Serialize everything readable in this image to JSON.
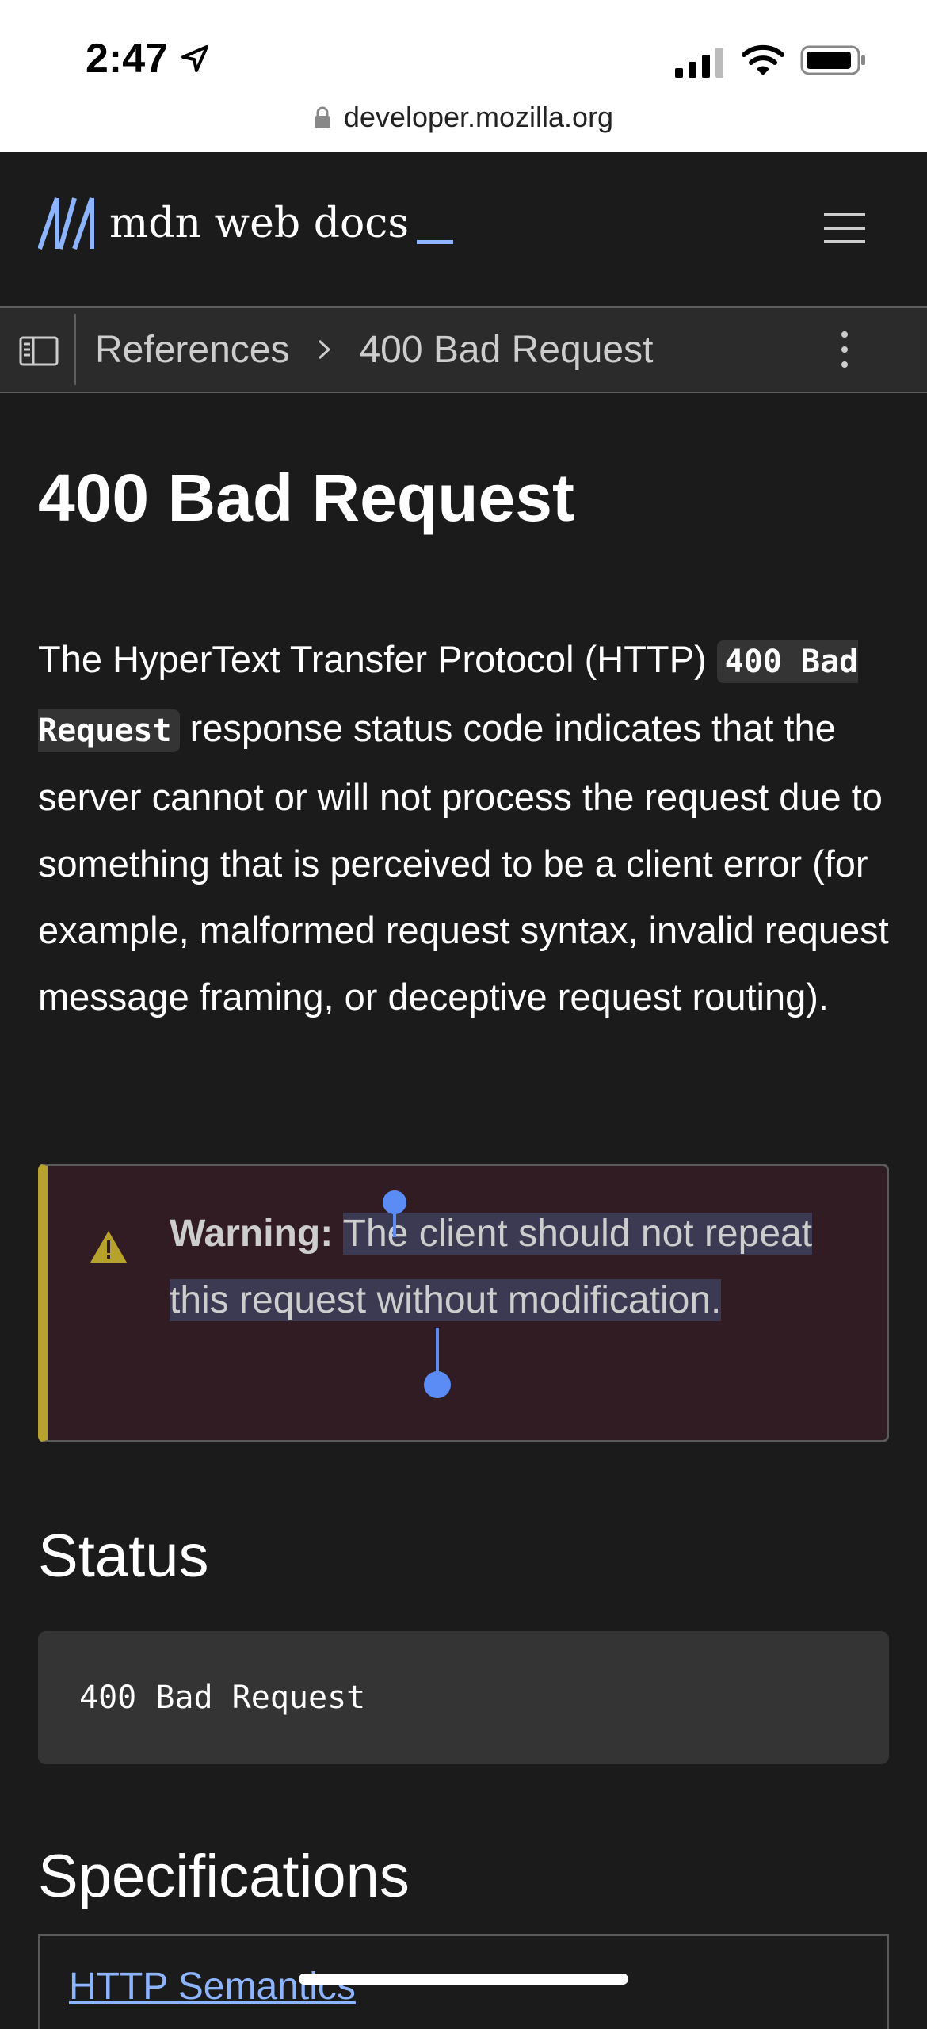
{
  "status_bar": {
    "time": "2:47",
    "url": "developer.mozilla.org"
  },
  "header": {
    "logo_text": "mdn web docs"
  },
  "breadcrumb": {
    "items": [
      "References",
      "400 Bad Request"
    ]
  },
  "article": {
    "title": "400 Bad Request",
    "intro_before_code": "The HyperText Transfer Protocol (HTTP) ",
    "intro_code": "400 Bad Request",
    "intro_after_code": " response status code indicates that the server cannot or will not process the request due to something that is perceived to be a client error (for example, malformed request syntax, invalid request message framing, or deceptive request routing).",
    "warning": {
      "label": "Warning:",
      "text": "The client should not repeat this request without modification."
    },
    "status_heading": "Status",
    "status_code": "400 Bad Request",
    "specs_heading": "Specifications",
    "spec_link": "HTTP Semantics"
  },
  "colors": {
    "background": "#1b1b1b",
    "accent_link": "#8cb4ff",
    "warning_bar": "#b8a22e",
    "warning_bg": "#301c22",
    "selection_handle": "#5b8cf6"
  },
  "icons": [
    "location-arrow-icon",
    "cellular-signal-icon",
    "wifi-icon",
    "battery-icon",
    "lock-icon",
    "mdn-logo-icon",
    "hamburger-menu-icon",
    "sidebar-toggle-icon",
    "chevron-right-icon",
    "kebab-menu-icon",
    "warning-triangle-icon"
  ]
}
